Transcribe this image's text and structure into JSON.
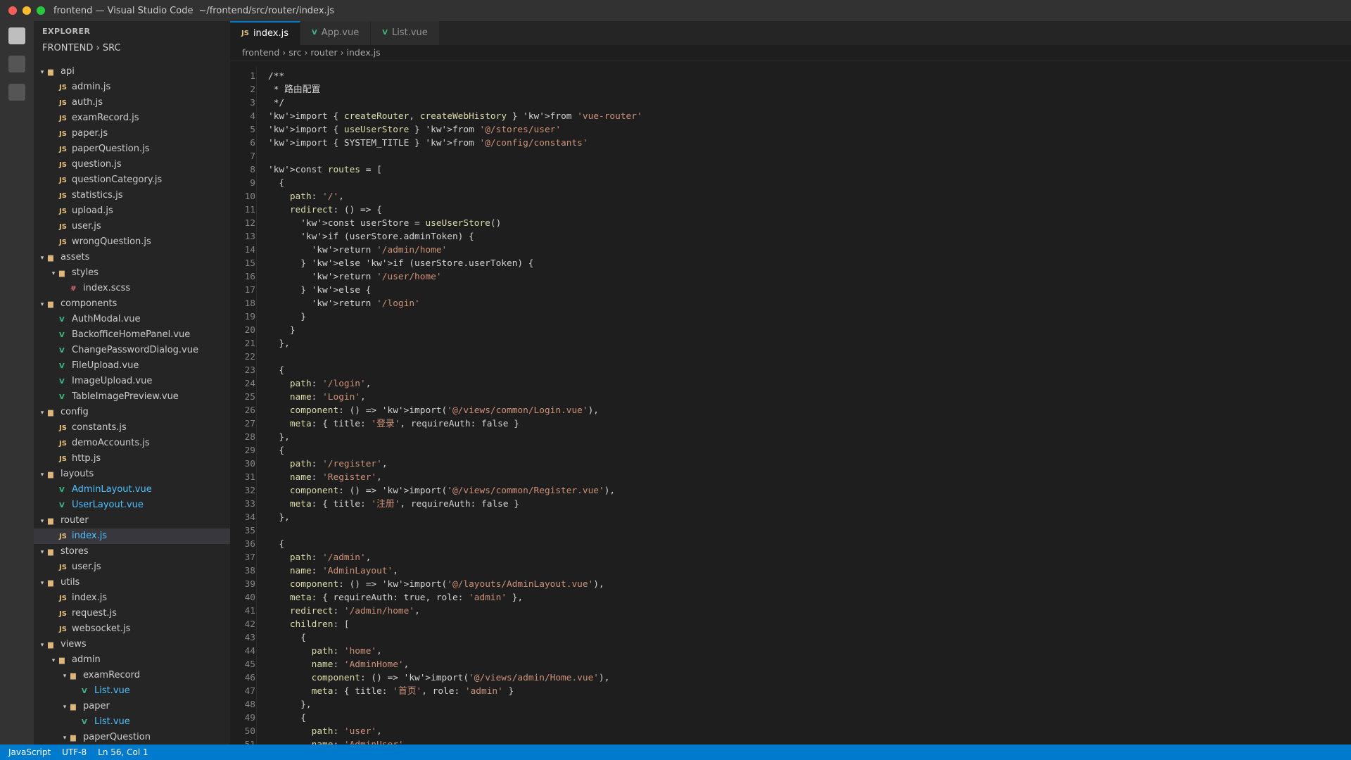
{
  "window": {
    "title": "frontend — Visual Studio Code",
    "path": "~/frontend/src/router/index.js",
    "lights": [
      "#ff5f57",
      "#febc2e",
      "#28c840"
    ]
  },
  "explorer": {
    "header": "EXPLORER",
    "root": "FRONTEND › SRC",
    "items": [
      {
        "label": "api",
        "kind": "folder",
        "depth": 0
      },
      {
        "label": "admin.js",
        "kind": "js",
        "depth": 1
      },
      {
        "label": "auth.js",
        "kind": "js",
        "depth": 1
      },
      {
        "label": "examRecord.js",
        "kind": "js",
        "depth": 1
      },
      {
        "label": "paper.js",
        "kind": "js",
        "depth": 1
      },
      {
        "label": "paperQuestion.js",
        "kind": "js",
        "depth": 1
      },
      {
        "label": "question.js",
        "kind": "js",
        "depth": 1
      },
      {
        "label": "questionCategory.js",
        "kind": "js",
        "depth": 1
      },
      {
        "label": "statistics.js",
        "kind": "js",
        "depth": 1
      },
      {
        "label": "upload.js",
        "kind": "js",
        "depth": 1
      },
      {
        "label": "user.js",
        "kind": "js",
        "depth": 1
      },
      {
        "label": "wrongQuestion.js",
        "kind": "js",
        "depth": 1
      },
      {
        "label": "assets",
        "kind": "folder",
        "depth": 0
      },
      {
        "label": "styles",
        "kind": "folder",
        "depth": 1
      },
      {
        "label": "index.scss",
        "kind": "scss",
        "depth": 2
      },
      {
        "label": "components",
        "kind": "folder",
        "depth": 0
      },
      {
        "label": "AuthModal.vue",
        "kind": "vue",
        "depth": 1
      },
      {
        "label": "BackofficeHomePanel.vue",
        "kind": "vue",
        "depth": 1
      },
      {
        "label": "ChangePasswordDialog.vue",
        "kind": "vue",
        "depth": 1
      },
      {
        "label": "FileUpload.vue",
        "kind": "vue",
        "depth": 1
      },
      {
        "label": "ImageUpload.vue",
        "kind": "vue",
        "depth": 1
      },
      {
        "label": "TableImagePreview.vue",
        "kind": "vue",
        "depth": 1
      },
      {
        "label": "config",
        "kind": "folder",
        "depth": 0
      },
      {
        "label": "constants.js",
        "kind": "js",
        "depth": 1
      },
      {
        "label": "demoAccounts.js",
        "kind": "js",
        "depth": 1
      },
      {
        "label": "http.js",
        "kind": "js",
        "depth": 1
      },
      {
        "label": "layouts",
        "kind": "folder",
        "depth": 0
      },
      {
        "label": "AdminLayout.vue",
        "kind": "vue",
        "depth": 1,
        "highlight": true
      },
      {
        "label": "UserLayout.vue",
        "kind": "vue",
        "depth": 1,
        "highlight": true
      },
      {
        "label": "router",
        "kind": "folder",
        "depth": 0
      },
      {
        "label": "index.js",
        "kind": "js",
        "depth": 1,
        "highlight": true,
        "active": true
      },
      {
        "label": "stores",
        "kind": "folder",
        "depth": 0
      },
      {
        "label": "user.js",
        "kind": "js",
        "depth": 1
      },
      {
        "label": "utils",
        "kind": "folder",
        "depth": 0
      },
      {
        "label": "index.js",
        "kind": "js",
        "depth": 1
      },
      {
        "label": "request.js",
        "kind": "js",
        "depth": 1
      },
      {
        "label": "websocket.js",
        "kind": "js",
        "depth": 1
      },
      {
        "label": "views",
        "kind": "folder",
        "depth": 0
      },
      {
        "label": "admin",
        "kind": "folder",
        "depth": 1
      },
      {
        "label": "examRecord",
        "kind": "folder",
        "depth": 2
      },
      {
        "label": "List.vue",
        "kind": "vue",
        "depth": 3,
        "highlight": true
      },
      {
        "label": "paper",
        "kind": "folder",
        "depth": 2
      },
      {
        "label": "List.vue",
        "kind": "vue",
        "depth": 3,
        "highlight": true
      },
      {
        "label": "paperQuestion",
        "kind": "folder",
        "depth": 2
      }
    ]
  },
  "tabs": [
    {
      "label": "index.js",
      "kind": "js",
      "active": true
    },
    {
      "label": "App.vue",
      "kind": "vue",
      "active": false
    },
    {
      "label": "List.vue",
      "kind": "vue",
      "active": false
    }
  ],
  "icons": {
    "js": "JS",
    "vue": "V",
    "scss": "#",
    "folder": "▆",
    "expanded": "▾"
  },
  "breadcrumb": "frontend › src › router › index.js",
  "colors": {
    "accent": "#007acc",
    "keyword": "#c586c0",
    "string": "#ce9178",
    "func": "#dcdcaa",
    "prop": "#9cdcfe",
    "comment": "#d4d4d4"
  },
  "code": [
    "/**",
    " * 路由配置",
    " */",
    "'kw'>import { createRouter, createWebHistory } 'kw'>from 'vue-router'",
    "'kw'>import { useUserStore } 'kw'>from '@/stores/user'",
    "'kw'>import { SYSTEM_TITLE } 'kw'>from '@/config/constants'",
    "",
    "'kw'>const routes = [",
    "  {",
    "    path: '/',",
    "    redirect: () => {",
    "      'kw'>const userStore = useUserStore()",
    "      'kw'>if (userStore.adminToken) {",
    "        'kw'>return '/admin/home'",
    "      } 'kw'>else 'kw'>if (userStore.userToken) {",
    "        'kw'>return '/user/home'",
    "      } 'kw'>else {",
    "        'kw'>return '/login'",
    "      }",
    "    }",
    "  },",
    "",
    "  {",
    "    path: '/login',",
    "    name: 'Login',",
    "    component: () => 'kw'>import('@/views/common/Login.vue'),",
    "    meta: { title: '登录', requireAuth: false }",
    "  },",
    "  {",
    "    path: '/register',",
    "    name: 'Register',",
    "    component: () => 'kw'>import('@/views/common/Register.vue'),",
    "    meta: { title: '注册', requireAuth: false }",
    "  },",
    "",
    "  {",
    "    path: '/admin',",
    "    name: 'AdminLayout',",
    "    component: () => 'kw'>import('@/layouts/AdminLayout.vue'),",
    "    meta: { requireAuth: true, role: 'admin' },",
    "    redirect: '/admin/home',",
    "    children: [",
    "      {",
    "        path: 'home',",
    "        name: 'AdminHome',",
    "        component: () => 'kw'>import('@/views/admin/Home.vue'),",
    "        meta: { title: '首页', role: 'admin' }",
    "      },",
    "      {",
    "        path: 'user',",
    "        name: 'AdminUser',"
  ],
  "status": {
    "language": "JavaScript",
    "encoding": "UTF-8",
    "position": "Ln 56, Col 1"
  }
}
